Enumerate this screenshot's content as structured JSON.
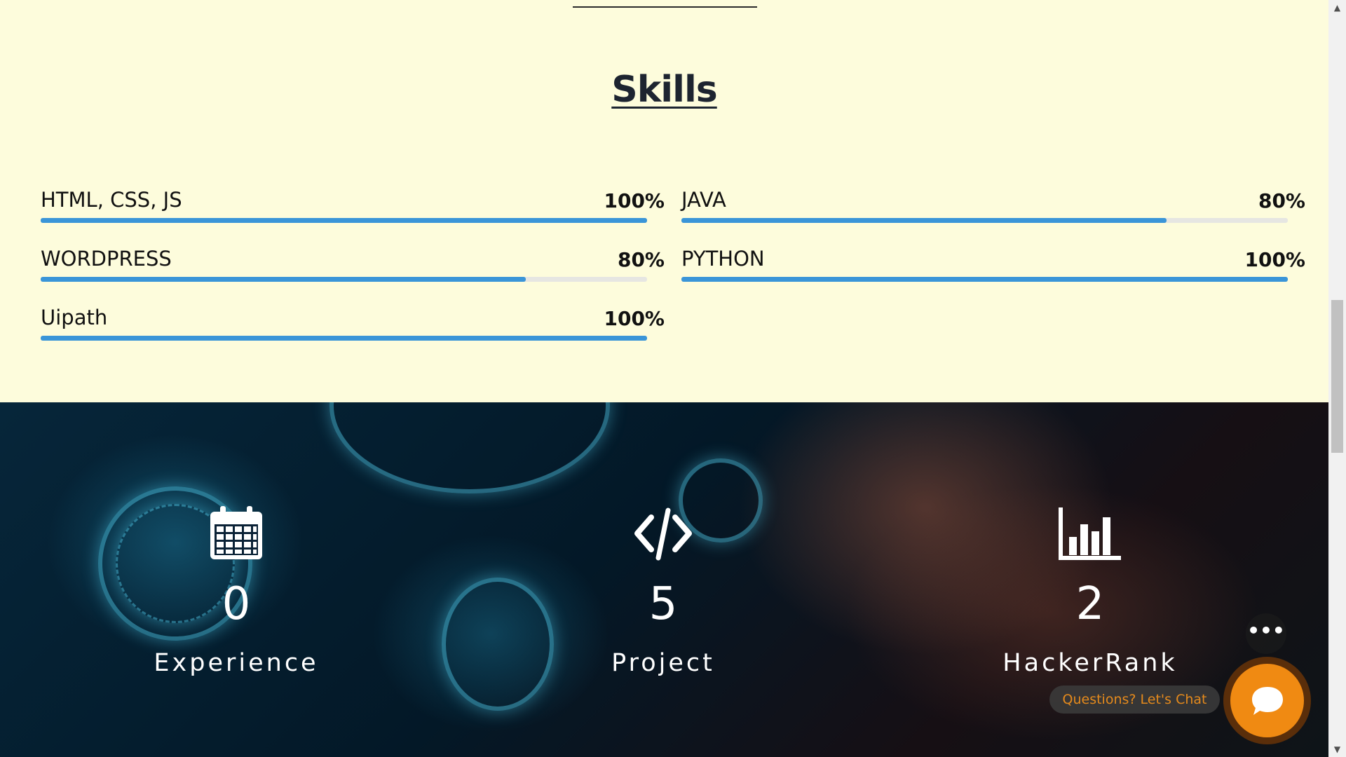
{
  "skills": {
    "title": "Skills",
    "items": [
      {
        "name": "HTML, CSS, JS",
        "percent_label": "100%",
        "level": 100
      },
      {
        "name": "JAVA",
        "percent_label": "80%",
        "level": 80
      },
      {
        "name": "WORDPRESS",
        "percent_label": "80%",
        "level": 80
      },
      {
        "name": "PYTHON",
        "percent_label": "100%",
        "level": 100
      },
      {
        "name": "Uipath",
        "percent_label": "100%",
        "level": 100
      }
    ]
  },
  "stats": [
    {
      "icon": "calendar-icon",
      "value": "0",
      "label": "Experience"
    },
    {
      "icon": "code-icon",
      "value": "5",
      "label": "Project"
    },
    {
      "icon": "bar-chart-icon",
      "value": "2",
      "label": "HackerRank"
    }
  ],
  "chat": {
    "prompt": "Questions? Let's Chat",
    "more_glyph": "•••",
    "accent": "#f08a12"
  },
  "colors": {
    "background": "#fdfcdc",
    "bar_fill": "#3a95d8",
    "bar_track": "#e6e6e2"
  }
}
